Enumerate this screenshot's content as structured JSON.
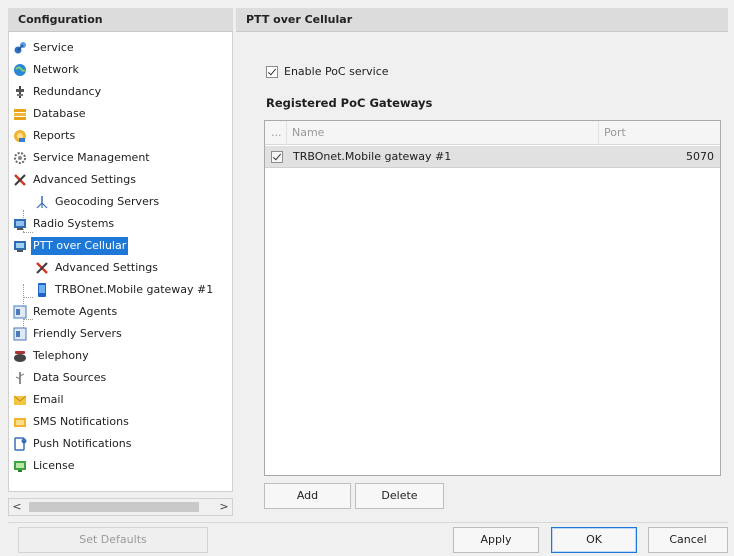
{
  "left_panel": {
    "title": "Configuration",
    "tree": [
      {
        "label": "Service",
        "icon": "service-icon",
        "depth": 0
      },
      {
        "label": "Network",
        "icon": "network-globe-icon",
        "depth": 0
      },
      {
        "label": "Redundancy",
        "icon": "redundancy-icon",
        "depth": 0
      },
      {
        "label": "Database",
        "icon": "database-icon",
        "depth": 0
      },
      {
        "label": "Reports",
        "icon": "reports-icon",
        "depth": 0
      },
      {
        "label": "Service Management",
        "icon": "gear-icon",
        "depth": 0
      },
      {
        "label": "Advanced Settings",
        "icon": "tools-icon",
        "depth": 0
      },
      {
        "label": "Geocoding Servers",
        "icon": "geocoding-icon",
        "depth": 1
      },
      {
        "label": "Radio Systems",
        "icon": "radio-systems-icon",
        "depth": 0
      },
      {
        "label": "PTT over Cellular",
        "icon": "ptt-cellular-icon",
        "depth": 0,
        "selected": true
      },
      {
        "label": "Advanced Settings",
        "icon": "tools-icon",
        "depth": 1
      },
      {
        "label": "TRBOnet.Mobile gateway #1",
        "icon": "mobile-phone-icon",
        "depth": 1
      },
      {
        "label": "Remote Agents",
        "icon": "remote-agents-icon",
        "depth": 0
      },
      {
        "label": "Friendly Servers",
        "icon": "friendly-servers-icon",
        "depth": 0
      },
      {
        "label": "Telephony",
        "icon": "telephone-icon",
        "depth": 0
      },
      {
        "label": "Data Sources",
        "icon": "data-sources-icon",
        "depth": 0
      },
      {
        "label": "Email",
        "icon": "email-icon",
        "depth": 0
      },
      {
        "label": "SMS Notifications",
        "icon": "sms-icon",
        "depth": 0
      },
      {
        "label": "Push Notifications",
        "icon": "push-notifications-icon",
        "depth": 0
      },
      {
        "label": "License",
        "icon": "license-icon",
        "depth": 0
      }
    ],
    "scroll_left": "<",
    "scroll_right": ">"
  },
  "right_panel": {
    "title": "PTT over Cellular",
    "enable_label": "Enable PoC service",
    "enable_checked": true,
    "section_title": "Registered PoC Gateways",
    "columns": {
      "select": "...",
      "name": "Name",
      "port": "Port"
    },
    "rows": [
      {
        "checked": true,
        "name": "TRBOnet.Mobile gateway #1",
        "port": "5070"
      }
    ],
    "add_label": "Add",
    "delete_label": "Delete"
  },
  "footer": {
    "set_defaults_label": "Set Defaults",
    "apply_label": "Apply",
    "ok_label": "OK",
    "cancel_label": "Cancel"
  },
  "colors": {
    "selection": "#1e78d7",
    "header_bg": "#dcdcdc",
    "row_bg": "#e1e1e1"
  }
}
